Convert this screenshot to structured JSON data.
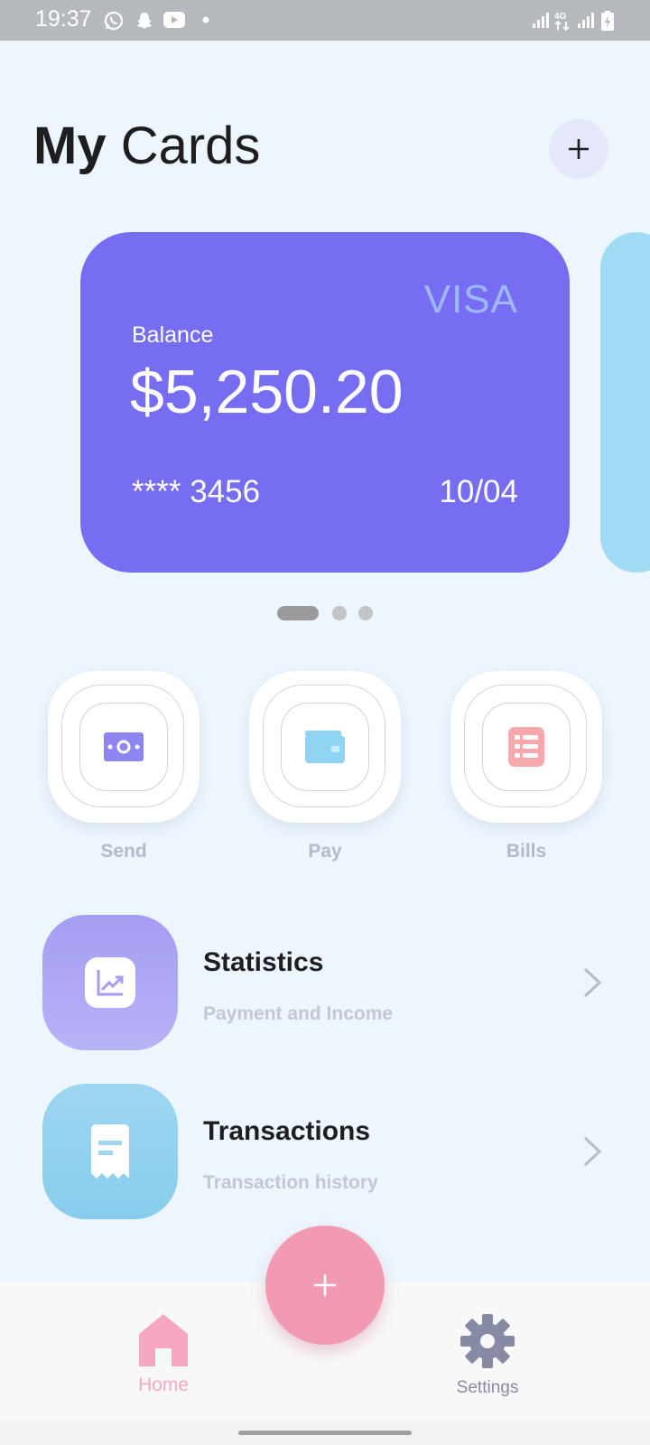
{
  "status_bar": {
    "time": "19:37",
    "left_icons": [
      "whatsapp-icon",
      "snapchat-icon",
      "youtube-icon",
      "dot-icon"
    ],
    "right_icons": [
      "signal-icon",
      "4g-icon",
      "signal-icon",
      "battery-charging-icon"
    ]
  },
  "header": {
    "title_word1": "My",
    "title_word2": "Cards",
    "add_icon": "plus-icon"
  },
  "card": {
    "brand": "VISA",
    "balance_label": "Balance",
    "balance": "$5,250.20",
    "number": "**** 3456",
    "expiry": "10/04",
    "color": "#766df3"
  },
  "pager": {
    "count": 3,
    "active": 1
  },
  "actions": [
    {
      "label": "Send",
      "icon": "banknote-icon",
      "color": "#8d86f2"
    },
    {
      "label": "Pay",
      "icon": "wallet-icon",
      "color": "#8fd4f3"
    },
    {
      "label": "Bills",
      "icon": "bill-list-icon",
      "color": "#f7a8ad"
    }
  ],
  "menu": [
    {
      "title": "Statistics",
      "subtitle": "Payment and Income",
      "icon": "chart-icon",
      "color": "#a9a2f4"
    },
    {
      "title": "Transactions",
      "subtitle": "Transaction history",
      "icon": "receipt-icon",
      "color": "#91d0ef"
    }
  ],
  "bottom_nav": {
    "home_label": "Home",
    "settings_label": "Settings",
    "home_color": "#f6a8c0",
    "settings_color": "#878aa4",
    "fab_icon": "plus-icon",
    "fab_color": "#f19ab1"
  }
}
